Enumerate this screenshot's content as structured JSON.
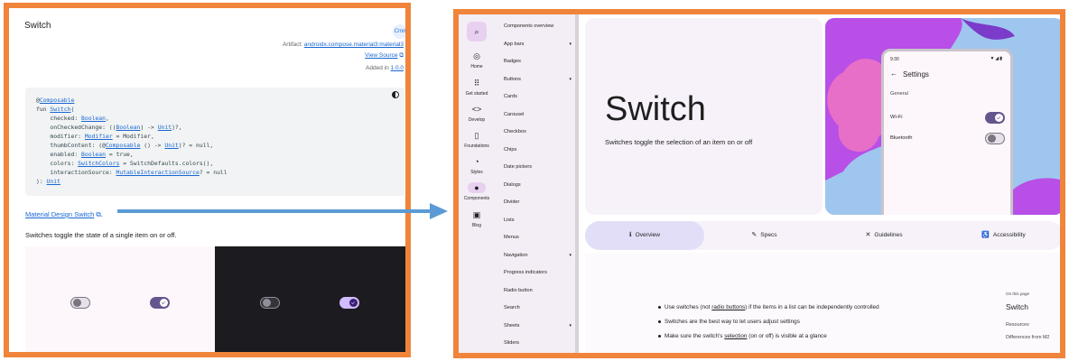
{
  "left_panel": {
    "title": "Switch",
    "badge": "Cmn",
    "artifact_label": "Artifact:",
    "artifact_link": "androidx.compose.material3:material3",
    "view_source": "View Source",
    "added_label": "Added in",
    "added_version": "1.0.0",
    "code": {
      "annotation_prefix": "@",
      "annotation": "Composable",
      "fun_kw": "fun ",
      "fun_name": "Switch",
      "paren": "(",
      "lines": [
        {
          "pre": "    checked: ",
          "link": "Boolean",
          "post": ","
        },
        {
          "pre": "    onCheckedChange: ((",
          "link": "Boolean",
          "mid": ") -> ",
          "link2": "Unit",
          "post": ")?,"
        },
        {
          "pre": "    modifier: ",
          "link": "Modifier",
          "post": " = Modifier,"
        },
        {
          "pre": "    thumbContent: (@",
          "link": "Composable",
          "mid": " () -> ",
          "link2": "Unit",
          "post": ")? = null,"
        },
        {
          "pre": "    enabled: ",
          "link": "Boolean",
          "post": " = true,"
        },
        {
          "pre": "    colors: ",
          "link": "SwitchColors",
          "post": " = SwitchDefaults.colors(),"
        },
        {
          "pre": "    interactionSource: ",
          "link": "MutableInteractionSource",
          "post": "? = null"
        }
      ],
      "close": "): ",
      "return_type": "Unit"
    },
    "material_link": "Material Design Switch",
    "material_link_suffix": ".",
    "description": "Switches toggle the state of a single item on or off."
  },
  "right_panel": {
    "rail": [
      {
        "label": "Home",
        "icon": "home-icon",
        "glyph": "◎"
      },
      {
        "label": "Get started",
        "icon": "grid-icon",
        "glyph": "⠿"
      },
      {
        "label": "Develop",
        "icon": "code-icon",
        "glyph": "<>"
      },
      {
        "label": "Foundations",
        "icon": "book-icon",
        "glyph": "▯"
      },
      {
        "label": "Styles",
        "icon": "palette-icon",
        "glyph": "◔"
      },
      {
        "label": "Components",
        "icon": "components-icon",
        "glyph": "●"
      },
      {
        "label": "Blog",
        "icon": "blog-icon",
        "glyph": "▣"
      }
    ],
    "nav_items": [
      {
        "label": "Components overview",
        "caret": ""
      },
      {
        "label": "App bars",
        "caret": "▾"
      },
      {
        "label": "Badges",
        "caret": ""
      },
      {
        "label": "Buttons",
        "caret": "▾"
      },
      {
        "label": "Cards",
        "caret": ""
      },
      {
        "label": "Carousel",
        "caret": ""
      },
      {
        "label": "Checkbox",
        "caret": ""
      },
      {
        "label": "Chips",
        "caret": ""
      },
      {
        "label": "Date pickers",
        "caret": ""
      },
      {
        "label": "Dialogs",
        "caret": ""
      },
      {
        "label": "Divider",
        "caret": ""
      },
      {
        "label": "Lists",
        "caret": ""
      },
      {
        "label": "Menus",
        "caret": ""
      },
      {
        "label": "Navigation",
        "caret": "▾"
      },
      {
        "label": "Progress indicators",
        "caret": ""
      },
      {
        "label": "Radio button",
        "caret": ""
      },
      {
        "label": "Search",
        "caret": ""
      },
      {
        "label": "Sheets",
        "caret": "▾"
      },
      {
        "label": "Sliders",
        "caret": ""
      }
    ],
    "hero_title": "Switch",
    "hero_subtitle": "Switches toggle the selection of an item on or off",
    "phone": {
      "time": "9:30",
      "status": "▼◢▮",
      "back": "←",
      "title": "Settings",
      "section": "General",
      "rows": [
        {
          "label": "Wi-Fi",
          "on": true
        },
        {
          "label": "Bluetooth",
          "on": false
        }
      ]
    },
    "tabs": [
      {
        "label": "Overview",
        "glyph": "ℹ",
        "icon": "info-icon"
      },
      {
        "label": "Specs",
        "glyph": "✎",
        "icon": "specs-icon"
      },
      {
        "label": "Guidelines",
        "glyph": "✕",
        "icon": "guidelines-icon"
      },
      {
        "label": "Accessibility",
        "glyph": "♿",
        "icon": "accessibility-icon"
      }
    ],
    "bullets": [
      {
        "pre": "Use switches (not ",
        "link": "radio buttons",
        "post": ") if the items in a list can be independently controlled"
      },
      {
        "pre": "Switches are the best way to let users adjust settings",
        "link": "",
        "post": ""
      },
      {
        "pre": "Make sure the switch's ",
        "link": "selection",
        "post": " (on or off) is visible at a glance"
      }
    ],
    "toc_label": "On this page",
    "toc_title": "Switch",
    "toc_items": [
      "Resources",
      "Differences from M2"
    ]
  },
  "colors": {
    "frame": "#f0843a",
    "arrow": "#5b9bd5",
    "primary": "#65558f",
    "art_bg": "#9fc6ee",
    "art_purple": "#b84fe6",
    "art_pink": "#e86fc8"
  }
}
